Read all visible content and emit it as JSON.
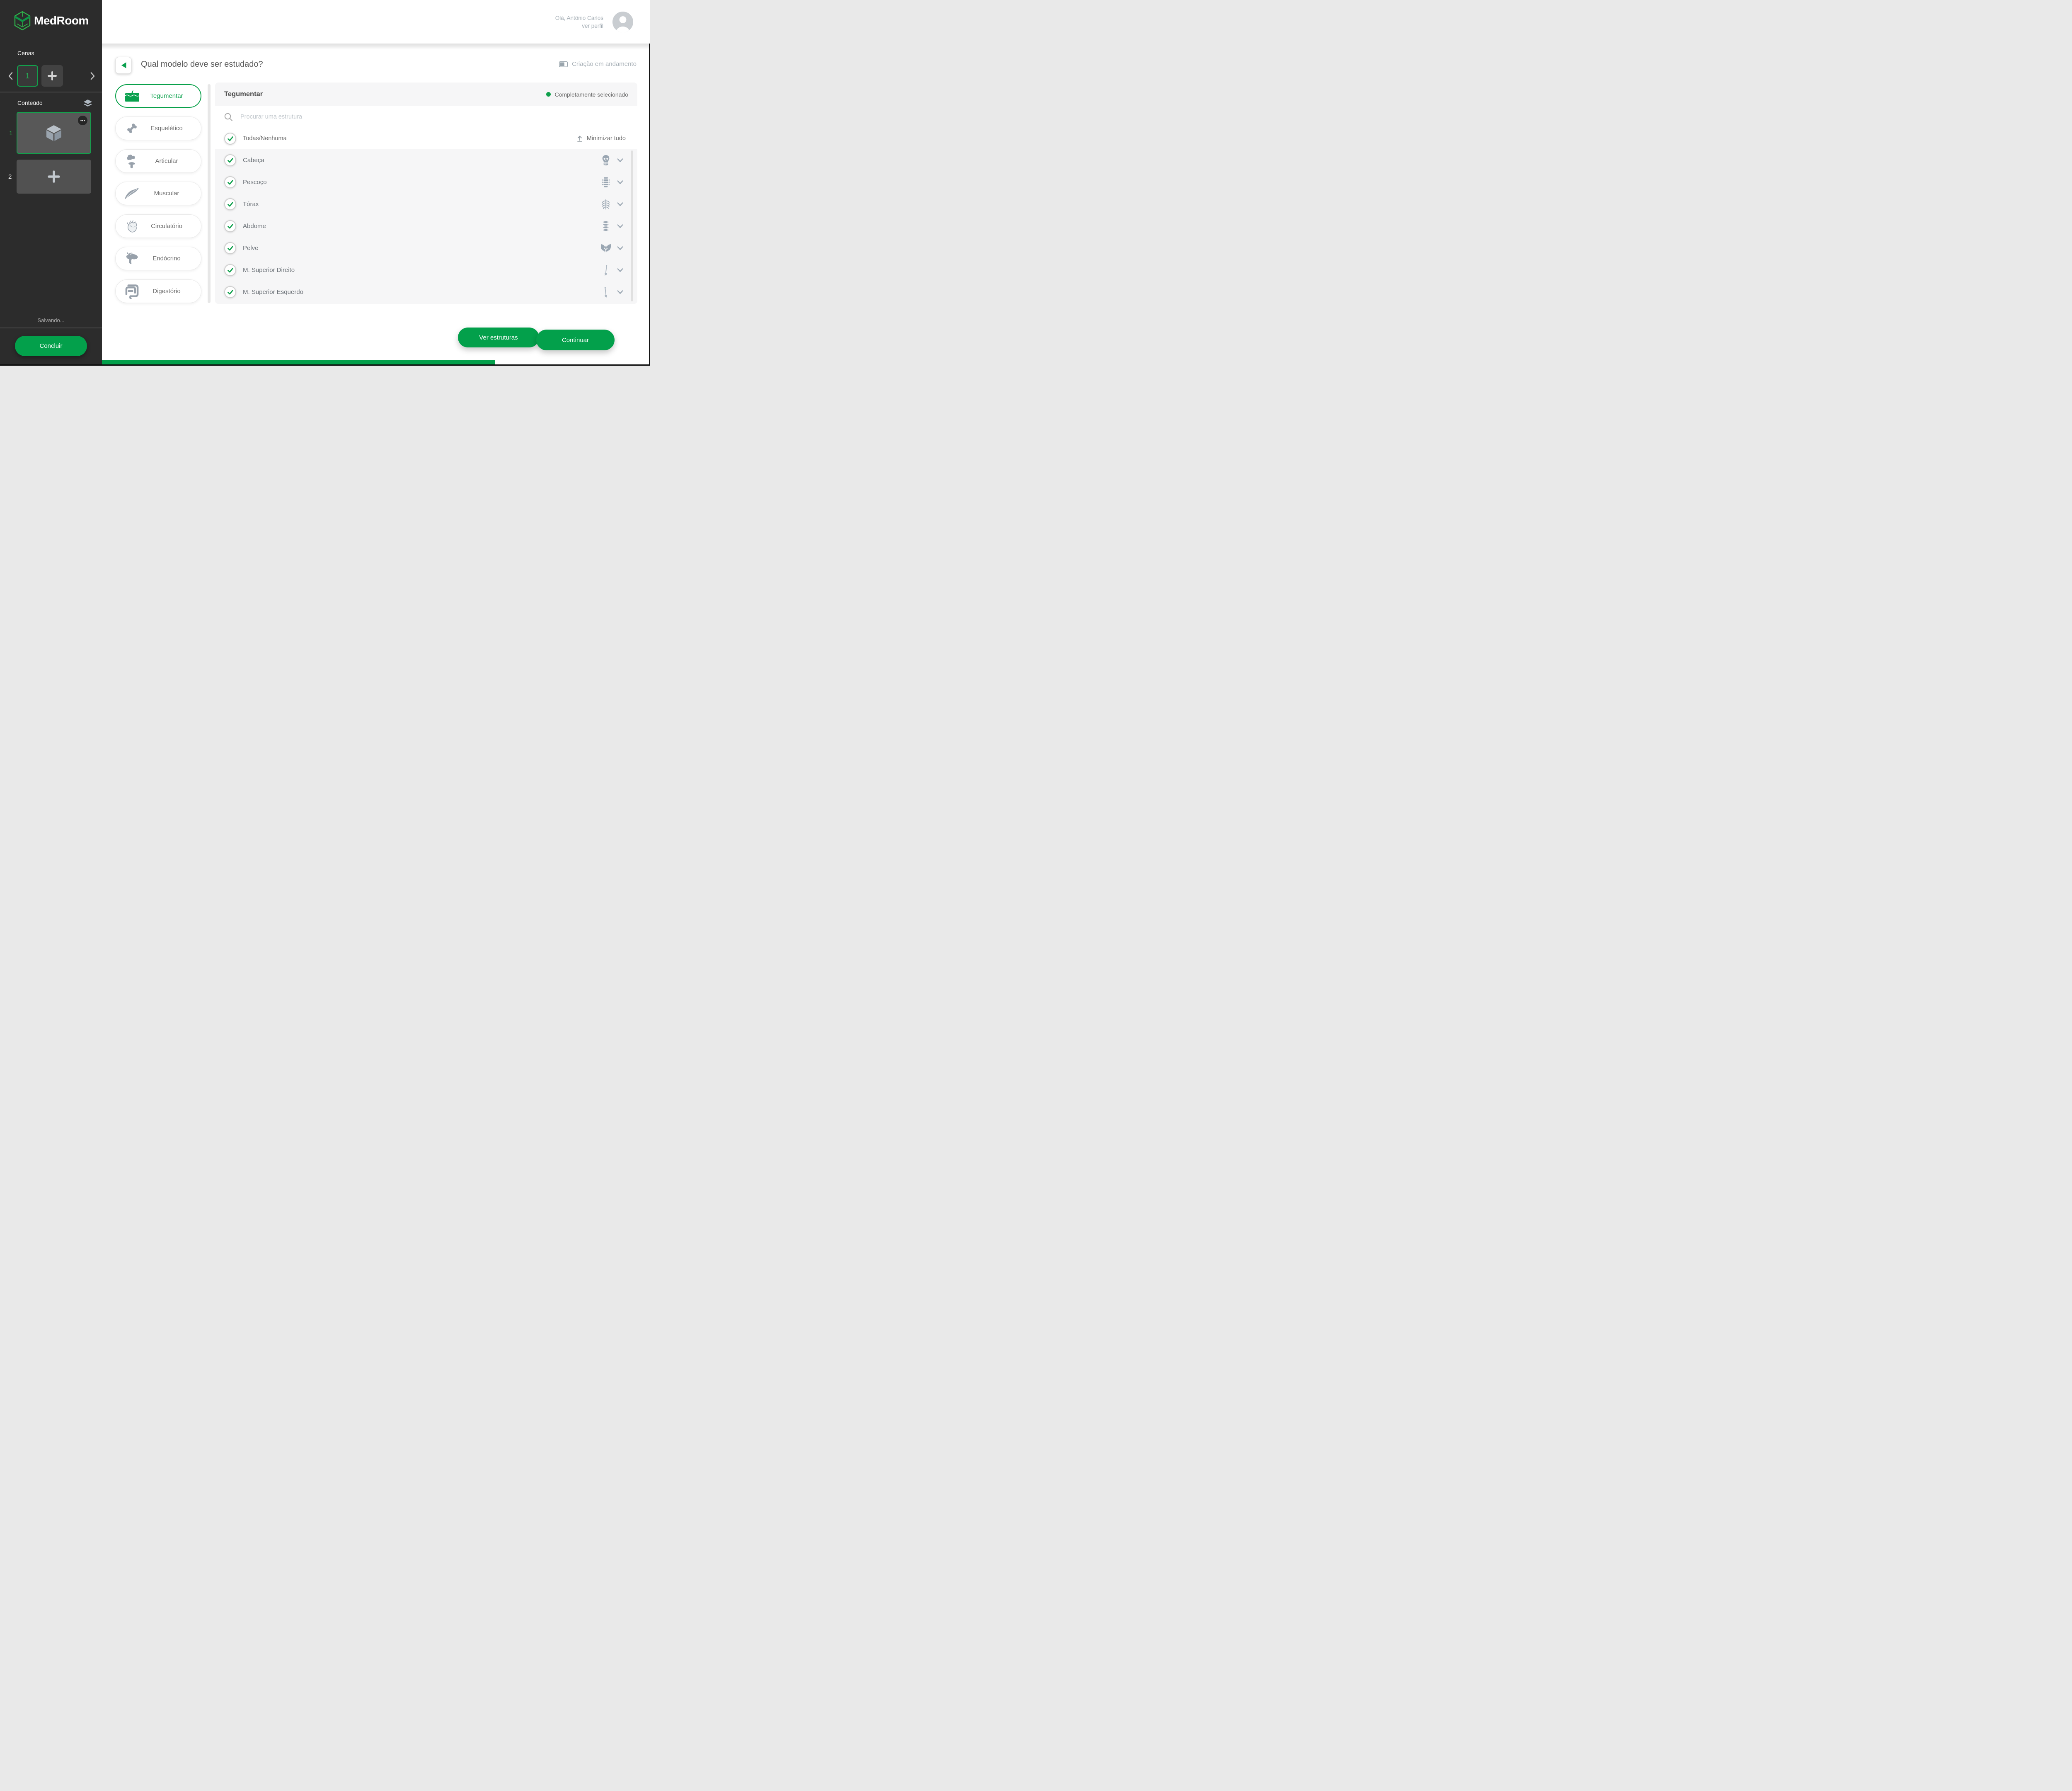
{
  "colors": {
    "accent_green": "#03A04B",
    "logo_green_light": "#2FB34B",
    "logo_green_dark": "#0E9546",
    "sidebar_bg": "#2C2C2C",
    "panel_bg": "#F6F6F7",
    "icon_gray_blue": "#9AA6B2"
  },
  "sidebar": {
    "brand": "MedRoom",
    "scenes": {
      "title": "Cenas",
      "active_scene": "1"
    },
    "content": {
      "title": "Conteúdo",
      "items": [
        {
          "index": "1",
          "type": "model-cube",
          "selected": true
        },
        {
          "index": "2",
          "type": "add-placeholder",
          "selected": false
        }
      ]
    },
    "saving_label": "Salvando...",
    "finish_button": "Concluir"
  },
  "header": {
    "greeting": "Olá, Antônio Carlos",
    "profile_link": "ver perfil"
  },
  "main": {
    "title": "Qual modelo deve ser estudado?",
    "creation_status": "Criação em andamento",
    "systems": [
      {
        "label": "Tegumentar",
        "icon": "skin-icon",
        "selected": true
      },
      {
        "label": "Esquelético",
        "icon": "bone-icon",
        "selected": false
      },
      {
        "label": "Articular",
        "icon": "joint-icon",
        "selected": false
      },
      {
        "label": "Muscular",
        "icon": "muscle-icon",
        "selected": false
      },
      {
        "label": "Circulatório",
        "icon": "heart-icon",
        "selected": false
      },
      {
        "label": "Endócrino",
        "icon": "pancreas-icon",
        "selected": false
      },
      {
        "label": "Digestório",
        "icon": "intestine-icon",
        "selected": false
      }
    ],
    "panel": {
      "title": "Tegumentar",
      "selection_status": "Completamente selecionado",
      "search_placeholder": "Procurar uma estrutura",
      "select_all_label": "Todas/Nenhuma",
      "collapse_all_label": "Minimizar tudo",
      "regions": [
        {
          "label": "Cabeça",
          "icon": "skull-icon",
          "checked": true
        },
        {
          "label": "Pescoço",
          "icon": "cervical-vertebrae-icon",
          "checked": true
        },
        {
          "label": "Tórax",
          "icon": "ribcage-icon",
          "checked": true
        },
        {
          "label": "Abdome",
          "icon": "lumbar-spine-icon",
          "checked": true
        },
        {
          "label": "Pelve",
          "icon": "pelvis-icon",
          "checked": true
        },
        {
          "label": "M. Superior Direito",
          "icon": "arm-bone-icon",
          "checked": true
        },
        {
          "label": "M. Superior Esquerdo",
          "icon": "arm-bone-icon",
          "checked": true
        }
      ]
    },
    "actions": {
      "view_structures": "Ver estruturas",
      "continue": "Continuar"
    }
  }
}
